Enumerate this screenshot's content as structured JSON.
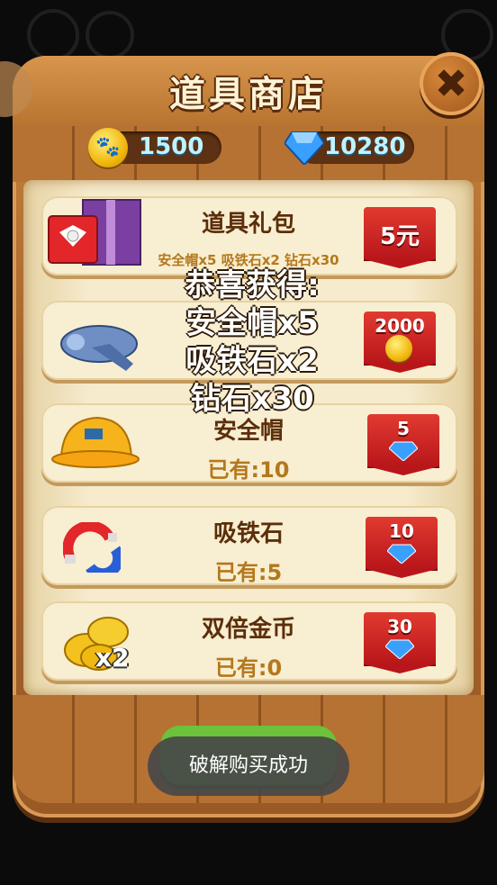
{
  "header": {
    "title": "道具商店",
    "close_label": "✖"
  },
  "currency": {
    "coins": "1500",
    "gems": "10280"
  },
  "items": [
    {
      "name": "道具礼包",
      "desc": "安全帽x5 吸铁石x2 钻石x30",
      "price": "5元",
      "price_type": "cash",
      "icon": "gift-box-icon"
    },
    {
      "name": "",
      "own": "",
      "price": "2000",
      "price_type": "coin",
      "icon": "airplane-icon"
    },
    {
      "name": "安全帽",
      "own": "已有:10",
      "price": "5",
      "price_type": "gem",
      "icon": "hard-hat-icon"
    },
    {
      "name": "吸铁石",
      "own": "已有:5",
      "price": "10",
      "price_type": "gem",
      "icon": "magnet-icon"
    },
    {
      "name": "双倍金币",
      "own": "已有:0",
      "price": "30",
      "price_type": "gem",
      "icon": "double-coins-icon",
      "badge": "x2"
    }
  ],
  "reward_popup": {
    "line1": "恭喜获得:",
    "line2": "安全帽x5",
    "line3": "吸铁石x2",
    "line4": "钻石x30"
  },
  "toast": {
    "text": "破解购买成功"
  },
  "colors": {
    "price_red": "#d8282a",
    "wood": "#b67233",
    "parchment": "#f6ebcd"
  }
}
